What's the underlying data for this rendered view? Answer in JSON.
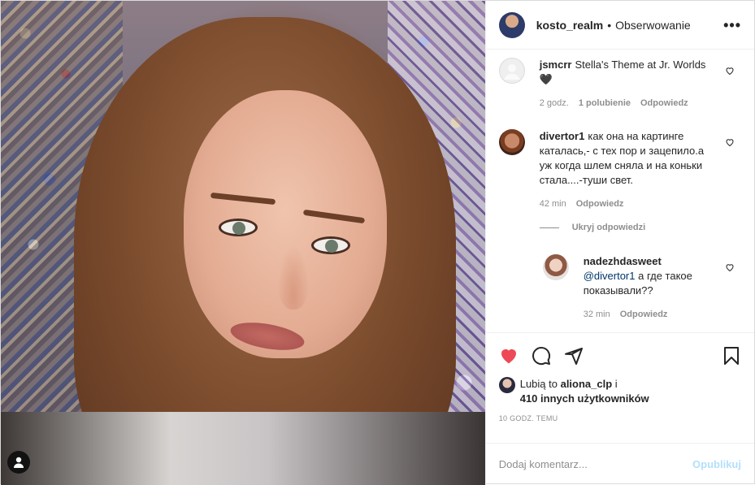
{
  "header": {
    "username": "kosto_realm",
    "separator": "•",
    "follow_label": "Obserwowanie",
    "more_icon": "more-horizontal-icon",
    "more_label": "•••"
  },
  "comments": [
    {
      "username": "jsmcrr",
      "text": "Stella's Theme at Jr. Worlds🖤",
      "time": "2 godz.",
      "likes": "1 polubienie",
      "reply": "Odpowiedz"
    },
    {
      "username": "divertor1",
      "text": "как она на картинге каталась,- с тех пор и зацепило.а уж когда шлем сняла и на коньки стала....-туши свет.",
      "time": "42 min",
      "reply": "Odpowiedz"
    }
  ],
  "hide_replies": "Ukryj odpowiedzi",
  "reply": {
    "username": "nadezhdasweet",
    "mention": "@divertor1",
    "text": " а где такое показывали??",
    "time": "32 min",
    "reply": "Odpowiedz"
  },
  "actions": {
    "like_icon": "heart-filled-icon",
    "comment_icon": "comment-icon",
    "share_icon": "share-icon",
    "save_icon": "bookmark-icon",
    "like_color": "#ed4956"
  },
  "likes": {
    "prefix": "Lubią to ",
    "user": "aliona_clp",
    "middle": " i",
    "others": "410 innych użytkowników"
  },
  "timestamp": "10 godz. temu",
  "add_comment": {
    "placeholder": "Dodaj komentarz...",
    "post_label": "Opublikuj"
  }
}
